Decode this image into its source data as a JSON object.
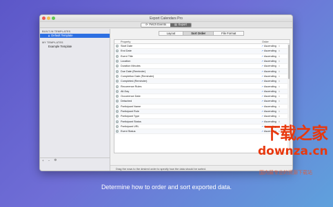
{
  "window": {
    "title": "Export Calendars Pro"
  },
  "toolbar": {
    "items": [
      {
        "label": "Fetch Events",
        "icon": "fetch-icon"
      },
      {
        "label": "Export",
        "icon": "export-icon"
      }
    ]
  },
  "sidebar": {
    "built_in_header": "BUILT-IN TEMPLATES",
    "built_in_items": [
      {
        "label": "Default Template"
      }
    ],
    "my_header": "MY TEMPLATES",
    "my_items": [
      {
        "label": "Example Template"
      }
    ],
    "bottom": {
      "add": "+",
      "remove": "−",
      "gear": "⚙"
    }
  },
  "tabs": [
    {
      "label": "Layout"
    },
    {
      "label": "Sort Order"
    },
    {
      "label": "File Format"
    }
  ],
  "table": {
    "headers": {
      "property": "Property",
      "order": "Order"
    },
    "rows": [
      {
        "property": "Start Date",
        "order": "Ascending"
      },
      {
        "property": "End Date",
        "order": "Ascending"
      },
      {
        "property": "Event Title",
        "order": "Ascending"
      },
      {
        "property": "Location",
        "order": "Ascending"
      },
      {
        "property": "Duration Minutes",
        "order": "Ascending"
      },
      {
        "property": "Due Date (Reminder)",
        "order": "Ascending"
      },
      {
        "property": "Completion Date (Reminder)",
        "order": "Ascending"
      },
      {
        "property": "Completed (Reminder)",
        "order": "Ascending"
      },
      {
        "property": "Recurrence Rules",
        "order": "Ascending"
      },
      {
        "property": "All-Day",
        "order": "Ascending"
      },
      {
        "property": "Occurrence Date",
        "order": "Ascending"
      },
      {
        "property": "Detached",
        "order": "Ascending"
      },
      {
        "property": "Participant Name",
        "order": "Ascending"
      },
      {
        "property": "Participant Role",
        "order": "Ascending"
      },
      {
        "property": "Participant Type",
        "order": "Ascending"
      },
      {
        "property": "Participant Status",
        "order": "Ascending"
      },
      {
        "property": "Participant URL",
        "order": "Ascending"
      },
      {
        "property": "Event Status",
        "order": "Ascending"
      }
    ]
  },
  "footer_text": "Drag the rows to the desired order to specify how the data should be sorted.",
  "caption": "Determine how to order and sort exported data.",
  "watermark": {
    "big": "下载之家",
    "url": "downza.cn",
    "sub": "国内最专业的资源下载站"
  }
}
